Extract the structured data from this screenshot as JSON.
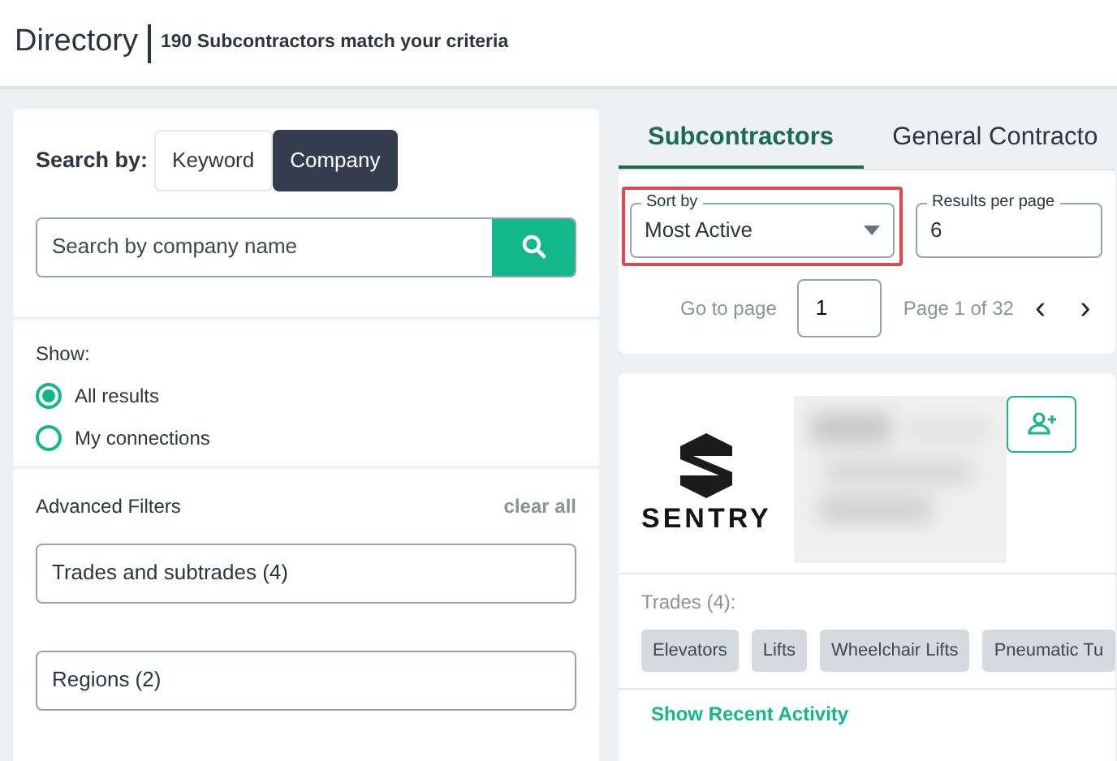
{
  "header": {
    "title": "Directory",
    "subtitle": "190 Subcontractors match your criteria"
  },
  "search": {
    "label": "Search by:",
    "modes": [
      {
        "label": "Keyword",
        "selected": false
      },
      {
        "label": "Company",
        "selected": true
      }
    ],
    "placeholder": "Search by company name"
  },
  "show": {
    "label": "Show:",
    "options": [
      {
        "label": "All results",
        "selected": true
      },
      {
        "label": "My connections",
        "selected": false
      }
    ]
  },
  "advanced_filters": {
    "title": "Advanced Filters",
    "clear": "clear all",
    "filters": [
      "Trades and subtrades (4)",
      "Regions (2)"
    ]
  },
  "tabs": [
    {
      "label": "Subcontractors",
      "selected": true
    },
    {
      "label": "General Contracto",
      "selected": false
    }
  ],
  "sort": {
    "label": "Sort by",
    "value": "Most Active",
    "highlighted": true
  },
  "per_page": {
    "label": "Results per page",
    "value": "6"
  },
  "pagination": {
    "goto_label": "Go to page",
    "page_value": "1",
    "page_info": "Page 1 of 32",
    "prev": "‹",
    "next": "›"
  },
  "company": {
    "logo_text": "SENTRY",
    "trades_label": "Trades (4):",
    "trades": [
      "Elevators",
      "Lifts",
      "Wheelchair Lifts",
      "Pneumatic Tu"
    ],
    "activity_link": "Show Recent Activity"
  }
}
